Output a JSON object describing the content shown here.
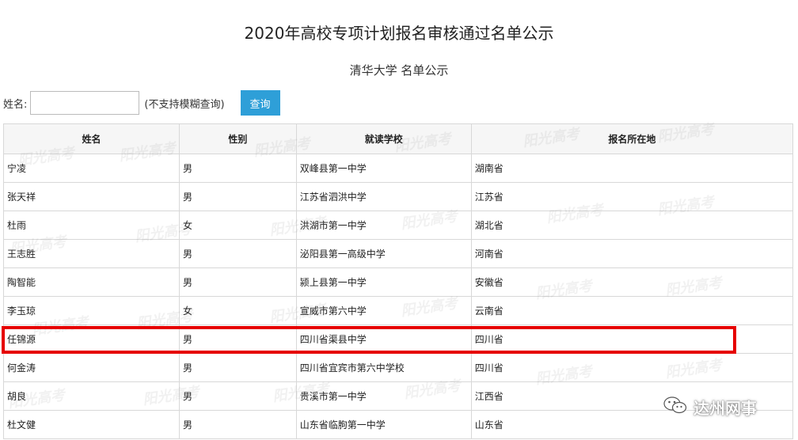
{
  "page": {
    "title": "2020年高校专项计划报名审核通过名单公示",
    "subtitle": "清华大学 名单公示"
  },
  "search": {
    "label": "姓名:",
    "value": "",
    "placeholder": "",
    "hint": "(不支持模糊查询)",
    "button": "查询"
  },
  "table": {
    "headers": [
      "姓名",
      "性别",
      "就读学校",
      "报名所在地"
    ],
    "rows": [
      [
        "宁凌",
        "男",
        "双峰县第一中学",
        "湖南省"
      ],
      [
        "张天祥",
        "男",
        "江苏省泗洪中学",
        "江苏省"
      ],
      [
        "杜雨",
        "女",
        "洪湖市第一中学",
        "湖北省"
      ],
      [
        "王志胜",
        "男",
        "泌阳县第一高级中学",
        "河南省"
      ],
      [
        "陶智能",
        "男",
        "颍上县第一中学",
        "安徽省"
      ],
      [
        "李玉琼",
        "女",
        "宣威市第六中学",
        "云南省"
      ],
      [
        "任锦源",
        "男",
        "四川省渠县中学",
        "四川省"
      ],
      [
        "何金涛",
        "男",
        "四川省宜宾市第六中学校",
        "四川省"
      ],
      [
        "胡良",
        "男",
        "贵溪市第一中学",
        "江西省"
      ],
      [
        "杜文健",
        "男",
        "山东省临朐第一中学",
        "山东省"
      ]
    ]
  },
  "highlighted_row": 6,
  "watermark_text": "阳光高考",
  "brand": {
    "icon": "wechat-icon",
    "text": "达州网事"
  },
  "colors": {
    "accent": "#2e9fd8",
    "highlight": "#e60000"
  }
}
